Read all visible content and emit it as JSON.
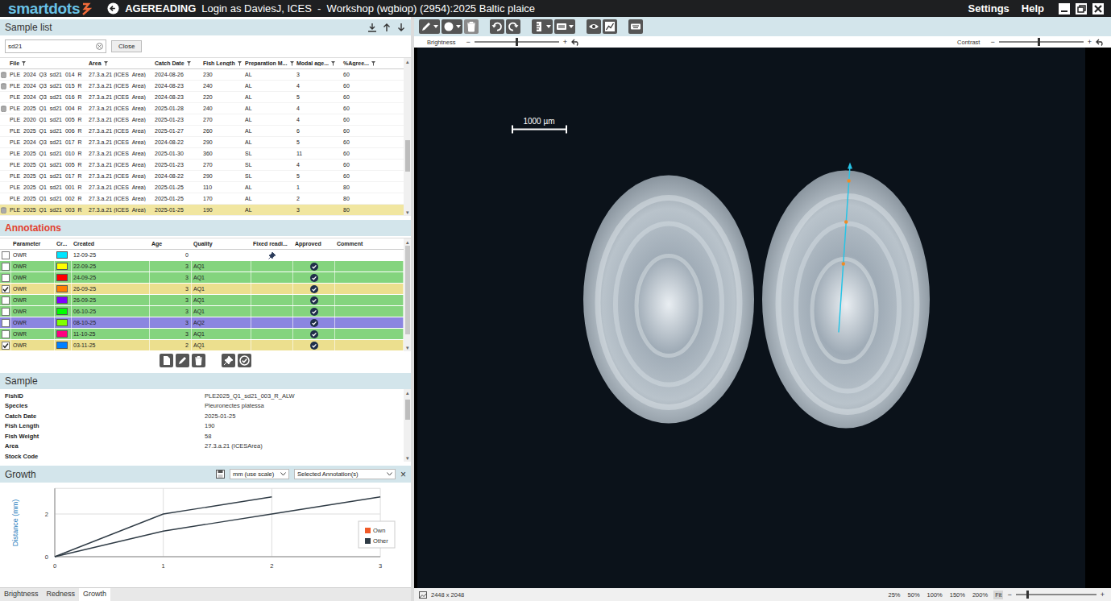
{
  "window": {
    "logo": "smartdots",
    "mode": "AGEREADING",
    "title": "Login as DaviesJ, ICES  -  Workshop (wgbiop) (2954):2025 Baltic plaice",
    "menu": [
      "Settings",
      "Help"
    ]
  },
  "sample_list": {
    "title": "Sample list",
    "search": {
      "value": "sd21"
    },
    "close_button": "Close",
    "columns": [
      "File",
      "Area",
      "Catch Date",
      "Fish Length",
      "Preparation M...",
      "Modal age...",
      "%Agree..."
    ],
    "rows": [
      {
        "stored": true,
        "selected": false,
        "cells": [
          "PLE_2024_Q3_sd21_014_R",
          "27.3.a.21 (ICES_Area)",
          "2024-08-26",
          "230",
          "AL",
          "3",
          "60"
        ]
      },
      {
        "stored": true,
        "selected": false,
        "cells": [
          "PLE_2024_Q3_sd21_015_R",
          "27.3.a.21 (ICES_Area)",
          "2024-08-23",
          "240",
          "AL",
          "4",
          "60"
        ]
      },
      {
        "stored": false,
        "selected": false,
        "cells": [
          "PLE_2024_Q3_sd21_016_R",
          "27.3.a.21 (ICES_Area)",
          "2024-08-23",
          "220",
          "AL",
          "5",
          "60"
        ]
      },
      {
        "stored": true,
        "selected": false,
        "cells": [
          "PLE_2025_Q1_sd21_004_R",
          "27.3.a.21 (ICES_Area)",
          "2025-01-28",
          "240",
          "AL",
          "4",
          "60"
        ]
      },
      {
        "stored": false,
        "selected": false,
        "cells": [
          "PLE_2020_Q1_sd21_005_R",
          "27.3.a.21 (ICES_Area)",
          "2025-01-23",
          "270",
          "AL",
          "4",
          "60"
        ]
      },
      {
        "stored": false,
        "selected": false,
        "cells": [
          "PLE_2025_Q1_sd21_006_R",
          "27.3.a.21 (ICES_Area)",
          "2025-01-27",
          "260",
          "AL",
          "6",
          "60"
        ]
      },
      {
        "stored": false,
        "selected": false,
        "cells": [
          "PLE_2024_Q3_sd21_017_R",
          "27.3.a.21 (ICES_Area)",
          "2024-08-22",
          "290",
          "AL",
          "5",
          "60"
        ]
      },
      {
        "stored": false,
        "selected": false,
        "cells": [
          "PLE_2025_Q1_sd21_010_R",
          "27.3.a.21 (ICES_Area)",
          "2025-01-30",
          "360",
          "SL",
          "11",
          "60"
        ]
      },
      {
        "stored": false,
        "selected": false,
        "cells": [
          "PLE_2025_Q1_sd21_005_R",
          "27.3.a.21 (ICES_Area)",
          "2025-01-23",
          "270",
          "SL",
          "4",
          "60"
        ]
      },
      {
        "stored": false,
        "selected": false,
        "cells": [
          "PLE_2025_Q1_sd21_017_R",
          "27.3.a.21 (ICES_Area)",
          "2024-08-22",
          "290",
          "SL",
          "5",
          "60"
        ]
      },
      {
        "stored": false,
        "selected": false,
        "cells": [
          "PLE_2025_Q1_sd21_001_R",
          "27.3.a.21 (ICES_Area)",
          "2025-01-25",
          "110",
          "AL",
          "1",
          "80"
        ]
      },
      {
        "stored": false,
        "selected": false,
        "cells": [
          "PLE_2025_Q1_sd21_002_R",
          "27.3.a.21 (ICES_Area)",
          "2025-01-25",
          "170",
          "AL",
          "2",
          "80"
        ]
      },
      {
        "stored": true,
        "selected": true,
        "cells": [
          "PLE_2025_Q1_sd21_003_R",
          "27.3.a.21 (ICES_Area)",
          "2025-01-25",
          "190",
          "AL",
          "3",
          "80"
        ]
      }
    ]
  },
  "annotations": {
    "title": "Annotations",
    "columns": [
      "Parameter",
      "Cr...",
      "Created",
      "Age",
      "Quality",
      "Fixed readi...",
      "Approved",
      "Comment"
    ],
    "rows": [
      {
        "checked": false,
        "parameter": "OWR",
        "color": "#00e5ff",
        "created": "12-09-25",
        "age": "0",
        "quality": "",
        "fixed": true,
        "approved": false,
        "selected": false,
        "focused": false,
        "comment": ""
      },
      {
        "checked": false,
        "parameter": "OWR",
        "color": "#ffff00",
        "created": "22-09-25",
        "age": "3",
        "quality": "AQ1",
        "fixed": false,
        "approved": true,
        "selected": false,
        "focused": false,
        "comment": ""
      },
      {
        "checked": false,
        "parameter": "OWR",
        "color": "#ff0000",
        "created": "24-09-25",
        "age": "3",
        "quality": "AQ1",
        "fixed": false,
        "approved": true,
        "selected": false,
        "focused": false,
        "comment": ""
      },
      {
        "checked": true,
        "parameter": "OWR",
        "color": "#ff8000",
        "created": "26-09-25",
        "age": "3",
        "quality": "AQ1",
        "fixed": false,
        "approved": true,
        "selected": true,
        "focused": false,
        "comment": ""
      },
      {
        "checked": false,
        "parameter": "OWR",
        "color": "#8000ff",
        "created": "26-09-25",
        "age": "3",
        "quality": "AQ1",
        "fixed": false,
        "approved": true,
        "selected": false,
        "focused": false,
        "comment": ""
      },
      {
        "checked": false,
        "parameter": "OWR",
        "color": "#00ff00",
        "created": "06-10-25",
        "age": "3",
        "quality": "AQ1",
        "fixed": false,
        "approved": true,
        "selected": false,
        "focused": false,
        "comment": ""
      },
      {
        "checked": false,
        "parameter": "OWR",
        "color": "#80ff00",
        "created": "08-10-25",
        "age": "3",
        "quality": "AQ2",
        "fixed": false,
        "approved": true,
        "selected": false,
        "focused": true,
        "comment": ""
      },
      {
        "checked": false,
        "parameter": "OWR",
        "color": "#ff0080",
        "created": "11-10-25",
        "age": "3",
        "quality": "AQ1",
        "fixed": false,
        "approved": true,
        "selected": false,
        "focused": false,
        "comment": ""
      },
      {
        "checked": true,
        "parameter": "OWR",
        "color": "#0080ff",
        "created": "03-11-25",
        "age": "2",
        "quality": "AQ1",
        "fixed": false,
        "approved": true,
        "selected": true,
        "focused": false,
        "comment": ""
      }
    ]
  },
  "sample": {
    "title": "Sample",
    "fields": [
      {
        "label": "FishID",
        "value": "PLE2025_Q1_sd21_003_R_ALW"
      },
      {
        "label": "Species",
        "value": "Pleuronectes platessa"
      },
      {
        "label": "Catch Date",
        "value": "2025-01-25"
      },
      {
        "label": "Fish Length",
        "value": "190"
      },
      {
        "label": "Fish Weight",
        "value": "58"
      },
      {
        "label": "Area",
        "value": "27.3.a.21 (ICESArea)"
      },
      {
        "label": "Stock Code",
        "value": ""
      }
    ]
  },
  "growth": {
    "title": "Growth",
    "unit": "mm (use scale)",
    "selection": "Selected Annotation(s)",
    "close": "×",
    "y_label": "Distance (mm)",
    "y_ticks": [
      "0",
      "2"
    ],
    "x_ticks": [
      "0",
      "1",
      "2",
      "3"
    ],
    "legend": [
      {
        "label": "Own",
        "color": "#f05a28"
      },
      {
        "label": "Other",
        "color": "#2f3b45"
      }
    ],
    "series": [
      {
        "legend": "Other",
        "values": [
          0,
          2,
          2.8
        ]
      },
      {
        "legend": "Other",
        "values": [
          0,
          1.2,
          2,
          2.8
        ]
      }
    ]
  },
  "bottom_tabs": [
    {
      "label": "Brightness",
      "selected": false
    },
    {
      "label": "Redness",
      "selected": false
    },
    {
      "label": "Growth",
      "selected": true
    }
  ],
  "viewer": {
    "brightness": {
      "label": "Brightness",
      "minus": "−",
      "plus": "+",
      "level": 0.5
    },
    "contrast": {
      "label": "Contrast",
      "minus": "−",
      "plus": "+",
      "level": 0.47
    },
    "scale_bar": "1000 µm",
    "image_size": "2448 x 2048",
    "zoom": [
      {
        "label": "25%",
        "selected": false
      },
      {
        "label": "50%",
        "selected": false
      },
      {
        "label": "100%",
        "selected": false
      },
      {
        "label": "150%",
        "selected": false
      },
      {
        "label": "200%",
        "selected": false
      },
      {
        "label": "Fit",
        "selected": true
      }
    ],
    "zoom_slider": {
      "minus": "−",
      "plus": "+",
      "level": 0.14
    }
  }
}
